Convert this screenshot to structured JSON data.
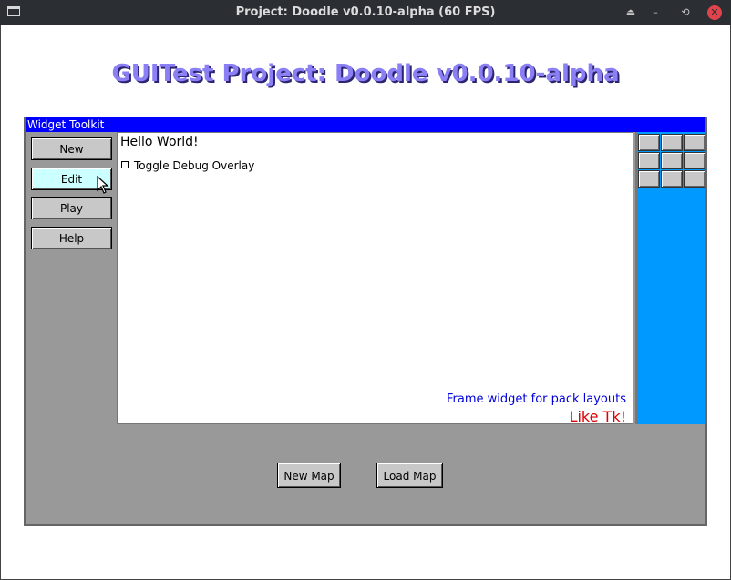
{
  "window": {
    "title": "Project: Doodle v0.0.10-alpha (60 FPS)",
    "controls": {
      "keep_above": "⏏",
      "minimize": "–",
      "restore": "⟲",
      "close": "✕"
    }
  },
  "heading": "GUITest Project: Doodle v0.0.10-alpha",
  "toolkit": {
    "title": "Widget Toolkit",
    "sidebar": [
      {
        "label": "New"
      },
      {
        "label": "Edit"
      },
      {
        "label": "Play"
      },
      {
        "label": "Help"
      }
    ],
    "frame": {
      "hello": "Hello World!",
      "checkbox_label": "Toggle Debug Overlay",
      "note": "Frame widget for pack layouts",
      "note2": "Like Tk!"
    },
    "bottom_buttons": {
      "new_map": "New Map",
      "load_map": "Load Map"
    }
  },
  "colors": {
    "toolkit_titlebar": "#0000ff",
    "right_panel": "#0099ff",
    "heading": "#8a7ff5",
    "hover_button": "#ccffff",
    "note_blue": "#0000dd",
    "note_red": "#e00000"
  },
  "icons": {
    "app": "window-icon",
    "cursor": "mouse-pointer-icon"
  }
}
